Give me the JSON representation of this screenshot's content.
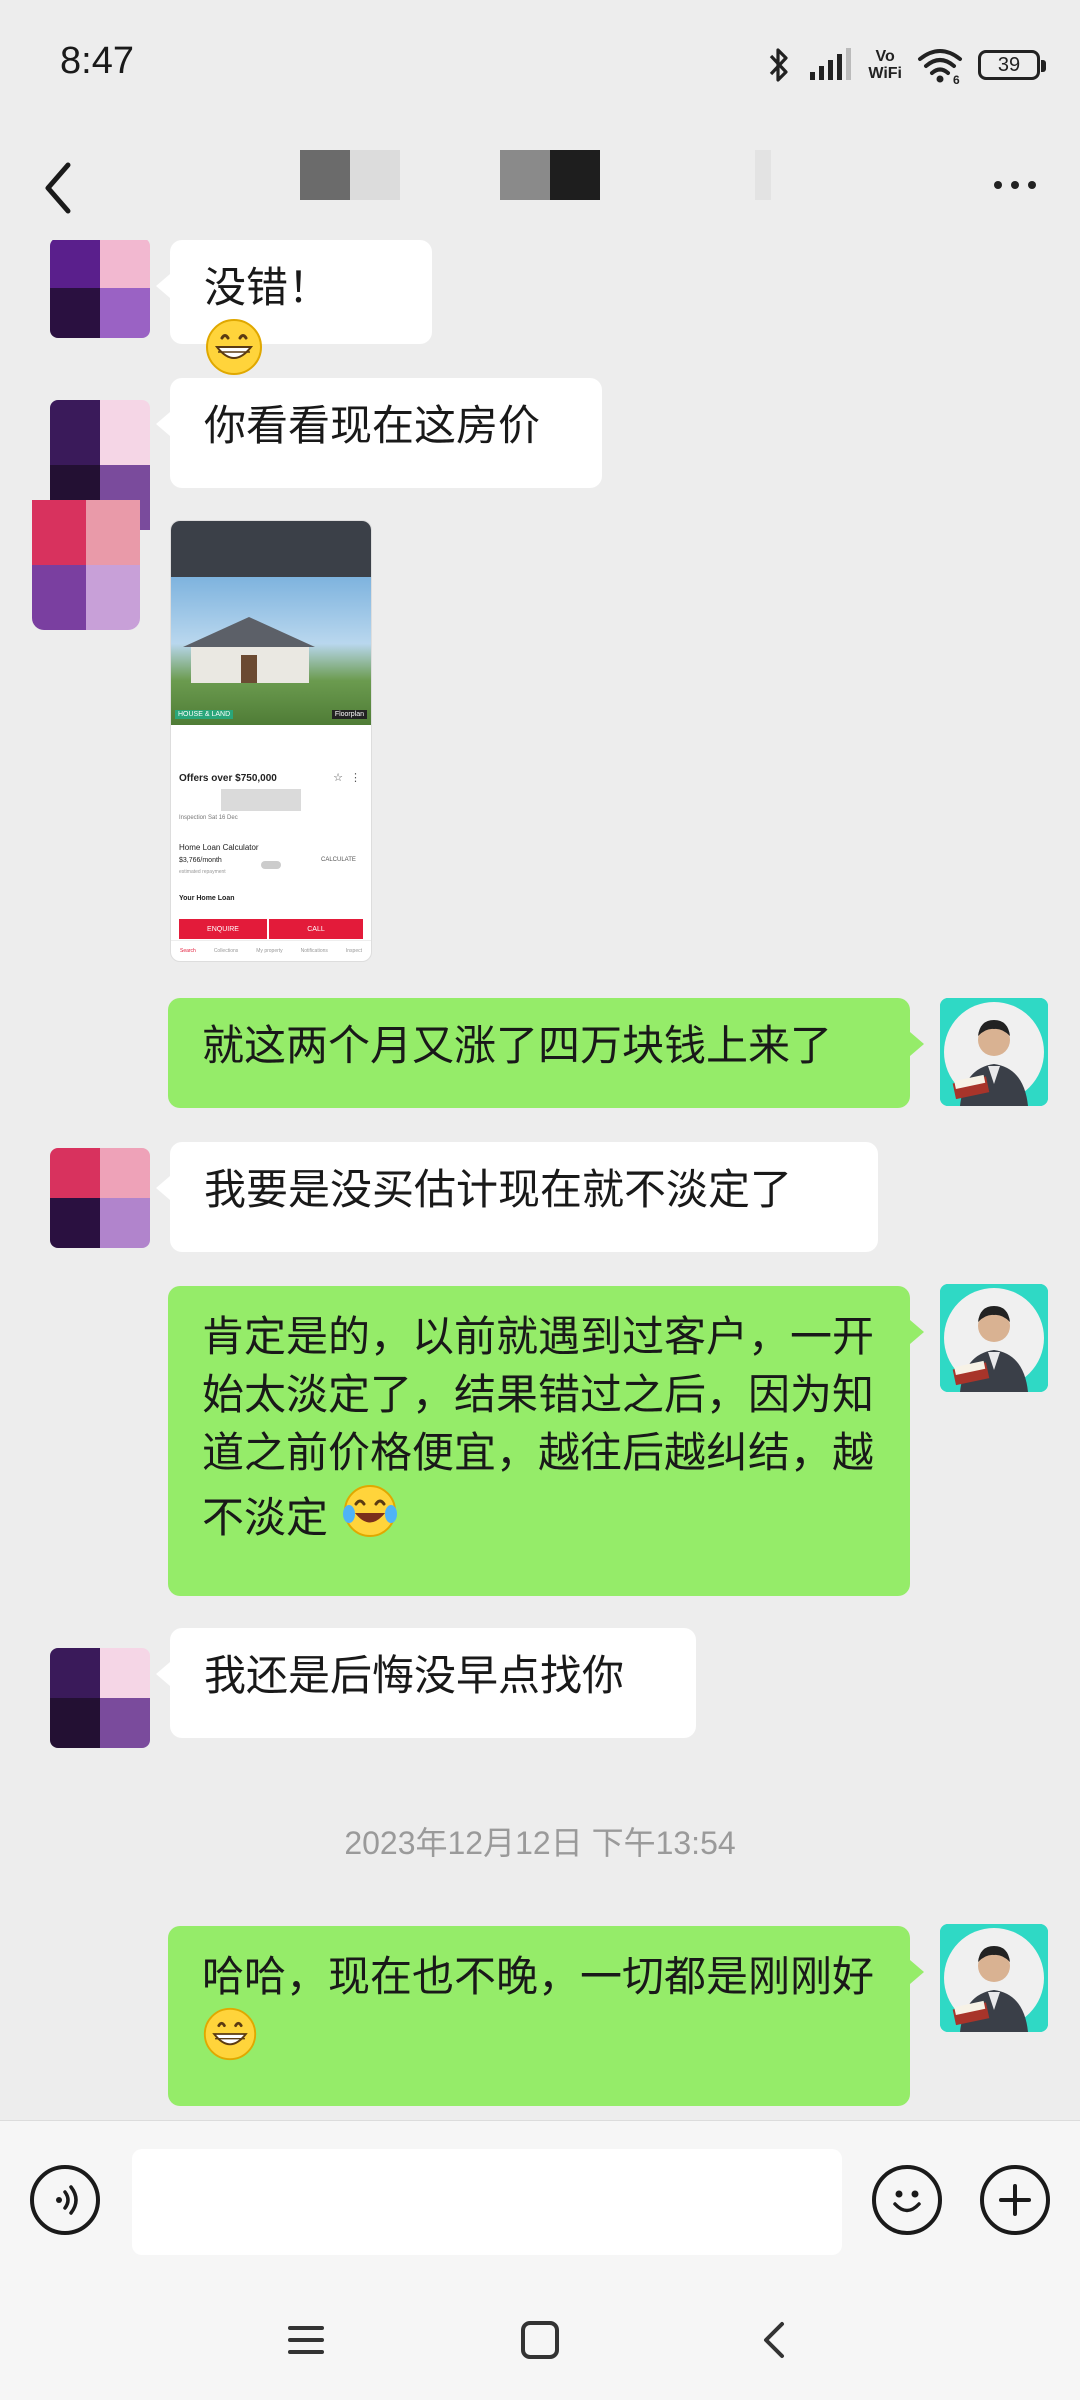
{
  "status_bar": {
    "time": "8:47",
    "network_label": "Vo\nWiFi",
    "wifi_sub": "6",
    "battery": "39"
  },
  "nav": {
    "title_obscured": true
  },
  "messages": [
    {
      "side": "left",
      "text": "没错！",
      "emoji": "grinning-face"
    },
    {
      "side": "left",
      "text": "你看看现在这房价"
    },
    {
      "side": "left",
      "type": "image",
      "image": {
        "offer_text": "Offers over $750,000",
        "inspection_text": "Inspection Sat 16 Dec",
        "calc_title": "Home Loan Calculator",
        "calc_amount": "$3,766/month",
        "calc_note": "estimated repayment",
        "calc_button": "CALCULATE",
        "loan_title": "Your Home Loan",
        "enquire": "ENQUIRE",
        "call": "CALL",
        "tag": "HOUSE & LAND",
        "floorplan": "Floorplan",
        "tabs": [
          "Search",
          "Collections",
          "My property",
          "Notifications",
          "Inspect"
        ]
      }
    },
    {
      "side": "right",
      "text": "就这两个月又涨了四万块钱上来了"
    },
    {
      "side": "left",
      "text": "我要是没买估计现在就不淡定了"
    },
    {
      "side": "right",
      "text": "肯定是的，以前就遇到过客户，一开始太淡定了，结果错过之后，因为知道之前价格便宜，越往后越纠结，越不淡定",
      "emoji": "tears-of-joy"
    },
    {
      "side": "left",
      "text": "我还是后悔没早点找你"
    },
    {
      "side": "right",
      "text": "哈哈，现在也不晚，一切都是刚刚好",
      "emoji": "grinning-face"
    }
  ],
  "timestamp": "2023年12月12日 下午13:54",
  "input": {
    "value": "",
    "placeholder": ""
  },
  "colors": {
    "chat_bg": "#ededed",
    "bubble_self": "#95ec69",
    "bubble_other": "#ffffff",
    "accent_red": "#e31b3a"
  },
  "icons": [
    "back-arrow-icon",
    "more-icon",
    "voice-icon",
    "emoji-icon",
    "plus-icon",
    "menu-icon",
    "home-icon",
    "back-icon",
    "bluetooth-icon",
    "signal-icon",
    "wifi-icon",
    "battery-icon"
  ]
}
